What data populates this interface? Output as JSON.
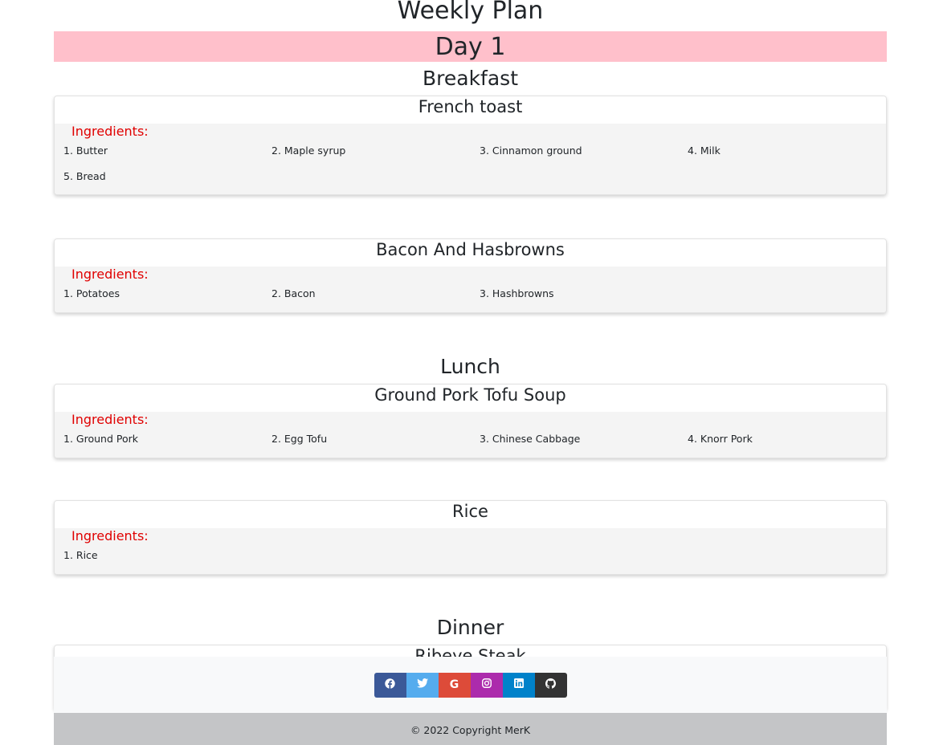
{
  "page": {
    "title": "Weekly Plan",
    "day_label": "Day 1"
  },
  "labels": {
    "ingredients": "Ingredients:"
  },
  "meals": {
    "breakfast": {
      "heading": "Breakfast",
      "recipes": [
        {
          "title": "French toast",
          "ingredients": [
            "1. Butter",
            "2. Maple syrup",
            "3. Cinnamon ground",
            "4. Milk",
            "5. Bread"
          ]
        },
        {
          "title": "Bacon And Hasbrowns",
          "ingredients": [
            "1. Potatoes",
            "2. Bacon",
            "3. Hashbrowns"
          ]
        }
      ]
    },
    "lunch": {
      "heading": "Lunch",
      "recipes": [
        {
          "title": "Ground Pork Tofu Soup",
          "ingredients": [
            "1. Ground Pork",
            "2. Egg Tofu",
            "3. Chinese Cabbage",
            "4. Knorr Pork"
          ]
        },
        {
          "title": "Rice",
          "ingredients": [
            "1. Rice"
          ]
        }
      ]
    },
    "dinner": {
      "heading": "Dinner",
      "recipes": [
        {
          "title": "Ribeye Steak"
        }
      ]
    }
  },
  "footer": {
    "social": [
      {
        "icon": "facebook-icon",
        "glyph": "f",
        "color": "#3b5998"
      },
      {
        "icon": "twitter-icon",
        "glyph": "🐦",
        "color": "#55acee"
      },
      {
        "icon": "google-icon",
        "glyph": "G",
        "color": "#dd4b39"
      },
      {
        "icon": "instagram-icon",
        "glyph": "◎",
        "color": "#ac2bac"
      },
      {
        "icon": "linkedin-icon",
        "glyph": "in",
        "color": "#0082ca"
      },
      {
        "icon": "github-icon",
        "glyph": "●",
        "color": "#333333"
      }
    ],
    "copyright_text": "© 2022 Copyright ",
    "copyright_link": "MerK"
  },
  "colors": {
    "day_banner": "#ffc0cb",
    "ingredients_label": "#e00000",
    "ingredients_bg": "#f4f4f4",
    "footer_social_bg": "#f8f9fa",
    "footer_copyright_bg": "#c4c5c7"
  }
}
